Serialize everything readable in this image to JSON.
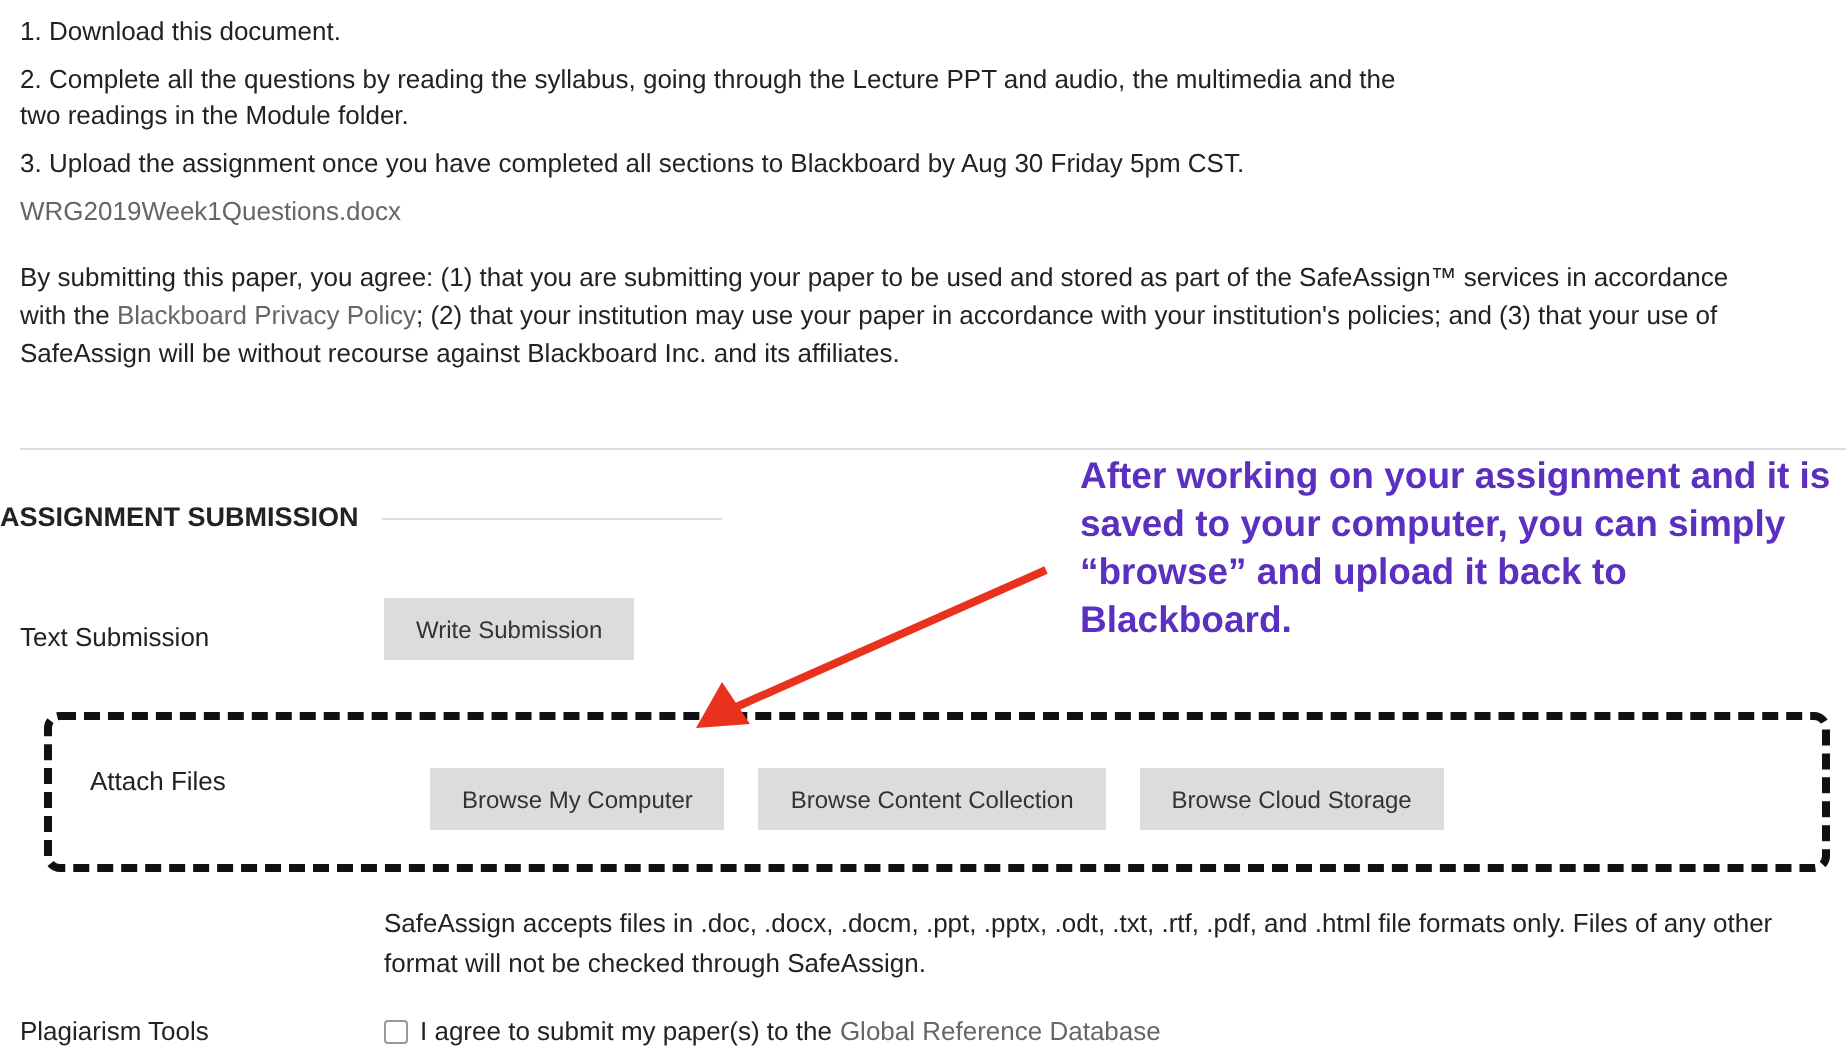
{
  "instructions": [
    "1. Download this document.",
    "2. Complete all the questions by reading the syllabus, going through the Lecture PPT and audio, the multimedia and the two readings in the Module folder.",
    "3. Upload the assignment once you have completed all sections to Blackboard by Aug 30 Friday 5pm CST."
  ],
  "attachment": "WRG2019Week1Questions.docx",
  "disclaimer": {
    "before": "By submitting this paper, you agree: (1) that you are submitting your paper to be used and stored as part of the SafeAssign™ services in accordance with the",
    "link": "Blackboard Privacy Policy",
    "after": "; (2) that your institution may use your paper in accordance with your institution's policies; and (3) that your use of SafeAssign will be without recourse against Blackboard Inc. and its affiliates."
  },
  "section_title": "ASSIGNMENT SUBMISSION",
  "annotation": "After working on your assignment and it is saved to your computer, you can simply “browse” and upload it back to Blackboard.",
  "text_submission": {
    "label": "Text Submission",
    "button": "Write Submission"
  },
  "attach_files": {
    "label": "Attach Files",
    "buttons": [
      "Browse My Computer",
      "Browse Content Collection",
      "Browse Cloud Storage"
    ]
  },
  "file_note": "SafeAssign accepts files in .doc, .docx, .docm, .ppt, .pptx, .odt, .txt, .rtf, .pdf, and .html file formats only. Files of any other format will not be checked through SafeAssign.",
  "plagiarism": {
    "label": "Plagiarism Tools",
    "checked": false,
    "text": "I agree to submit my paper(s) to the",
    "link": "Global Reference Database"
  }
}
